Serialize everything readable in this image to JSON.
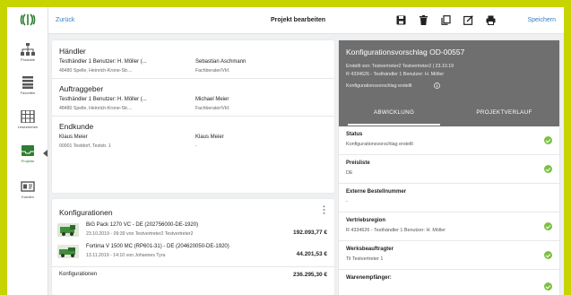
{
  "colors": {
    "accent": "#2f7fc8",
    "brand": "#2e7d32",
    "frame": "#c8d400",
    "panel_header": "#6f6f6f",
    "ok": "#7cc142"
  },
  "nav": {
    "items": [
      {
        "label": "Produkte",
        "icon": "sitemap-icon"
      },
      {
        "label": "Favoriten",
        "icon": "list-icon"
      },
      {
        "label": "Lesezeichen",
        "icon": "grid-icon"
      },
      {
        "label": "Projekte",
        "icon": "inbox-icon"
      },
      {
        "label": "Kunden",
        "icon": "id-card-icon"
      }
    ]
  },
  "topbar": {
    "back_label": "Zurück",
    "title": "Projekt bearbeiten",
    "save_label": "Speichern",
    "icons": [
      "save-icon",
      "delete-icon",
      "copy-icon",
      "edit-icon",
      "print-icon"
    ]
  },
  "parties": {
    "haendler": {
      "title": "Händler",
      "name": "Testhändler 1 Benutzer: H. Möller (...",
      "address": "48480 Spelle, Heinrich-Krone-Str....",
      "contact_name": "Sebastian Aschmann",
      "contact_role": "Fachberater/Vkf."
    },
    "auftraggeber": {
      "title": "Auftraggeber",
      "name": "Testhändler 1 Benutzer: H. Möller (...",
      "address": "48480 Spelle, Heinrich-Krone-Str....",
      "contact_name": "Michael Meier",
      "contact_role": "Fachberater/Vkf."
    },
    "endkunde": {
      "title": "Endkunde",
      "name": "Klaus Meier",
      "address": "00001 Testdorf, Teststr. 1",
      "contact_name": "Klaus Meier",
      "contact_role": "-"
    }
  },
  "konfigurationen": {
    "title": "Konfigurationen",
    "items": [
      {
        "name": "BiG Pack 1270 VC - DE (202756000-DE-1920)",
        "meta": "23.10.2019 - 09:39 von Testvertreter2 Testvertreter2",
        "price": "192.093,77 €"
      },
      {
        "name": "Fortima V 1500 MC (RP601-31) - DE (204620050-DE-1920)",
        "meta": "13.11.2019 - 14:10 von Johannes Tyra",
        "price": "44.201,53 €"
      }
    ],
    "total_label": "Konfigurationen",
    "total_value": "236.295,30 €"
  },
  "panel": {
    "title": "Konfigurationsvorschlag OD-00557",
    "created": "Erstellt von: Testvertreter2 Testvertreter2 | 23.10.19",
    "region": "R 4334626 - Testhändler 1 Benutzer: H. Möller",
    "state": "Konfigurationsvorschlag erstellt",
    "tabs": [
      "ABWICKLUNG",
      "PROJEKTVERLAUF"
    ],
    "rows": [
      {
        "label": "Status",
        "value": "Konfigurationsvorschlag erstellt"
      },
      {
        "label": "Preisliste",
        "value": "DE"
      },
      {
        "label": "Externe Bestellnummer",
        "value": "-"
      },
      {
        "label": "Vertriebsregion",
        "value": "R 4334626 - Testhändler 1 Benutzer: H. Möller"
      },
      {
        "label": "Werksbeauftragter",
        "value": "Til Testvertreter 1"
      },
      {
        "label": "Warenempfänger:",
        "value": ""
      }
    ]
  }
}
